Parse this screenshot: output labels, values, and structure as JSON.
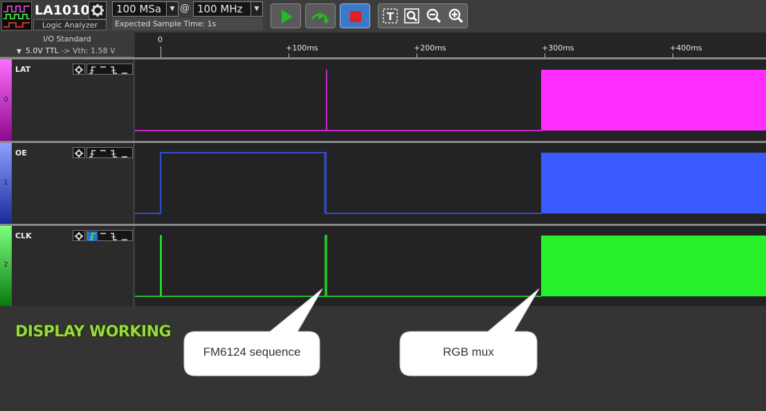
{
  "app": {
    "title": "LA1010",
    "subtitle": "Logic Analyzer"
  },
  "toolbar": {
    "sample_rate": "100 MSa",
    "at_symbol": "@",
    "frequency": "100 MHz",
    "expected_sample_time": "Expected Sample Time: 1s",
    "buttons": [
      "play-icon",
      "loop-play-icon",
      "stop-icon"
    ],
    "zoom_buttons": [
      "text-cursor-icon",
      "zoom-fit-icon",
      "zoom-out-icon",
      "zoom-in-icon"
    ],
    "colors": {
      "play": "#22bb22",
      "stop": "#e02020",
      "stop_bg": "#3b78c8"
    }
  },
  "io_standard": {
    "title": "I/O Standard",
    "value": "5.0V TTL",
    "vth": "-> Vth: 1.58 V"
  },
  "ruler": {
    "ticks": [
      "0",
      "+100ms",
      "+200ms",
      "+300ms",
      "+400ms"
    ]
  },
  "channels": [
    {
      "index": "0",
      "name": "LAT",
      "color": "#ff2dff",
      "strip_top": "#ff6dff",
      "strip_bottom": "#8c0a8c"
    },
    {
      "index": "1",
      "name": "OE",
      "color": "#3a5cff",
      "strip_top": "#8aa0ff",
      "strip_bottom": "#1a2a9a"
    },
    {
      "index": "2",
      "name": "CLK",
      "color": "#26f02a",
      "strip_top": "#7bff7b",
      "strip_bottom": "#0a7a12"
    }
  ],
  "annotations": {
    "headline": "DISPLAY WORKING",
    "callout_1": "FM6124 sequence",
    "callout_2": "RGB mux"
  }
}
